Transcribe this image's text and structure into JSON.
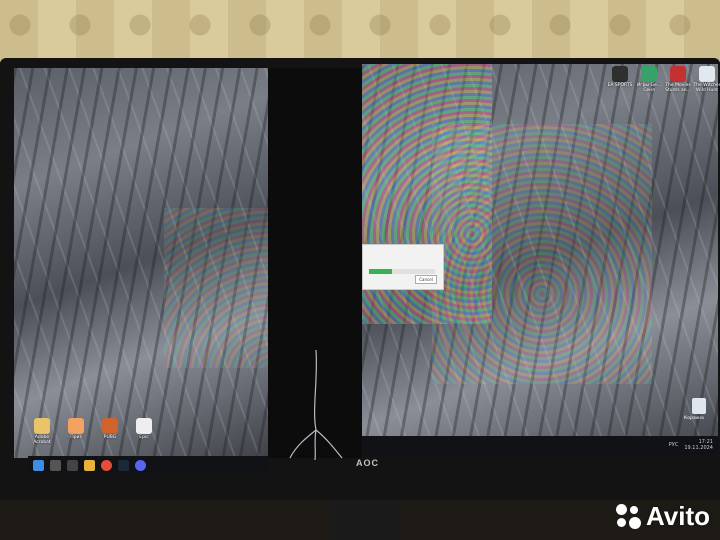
{
  "left_screen": {
    "desktop_icons": [
      {
        "label": "Adobe Acrobat",
        "color": "#e9c46a"
      },
      {
        "label": "Приз",
        "color": "#f4a261"
      },
      {
        "label": "PUBG",
        "color": "#d0632b"
      },
      {
        "label": "Epic",
        "color": "#eeeeee"
      }
    ]
  },
  "right_screen": {
    "desktop_icons": [
      {
        "label": "EA SPORTS",
        "color": "#2f2f2f"
      },
      {
        "label": "Игры Ge... Сеня",
        "color": "#38a169"
      },
      {
        "label": "The Movies Stunts an...",
        "color": "#c53030"
      },
      {
        "label": "The Witcher Wild Hunt",
        "color": "#e2e8f0"
      }
    ],
    "dialog": {
      "button": "Cancel",
      "progress": 0.35
    },
    "recycle_bin_label": "Корзина",
    "tray": {
      "lang": "РУС",
      "time": "17:21",
      "date": "19.11.2024"
    }
  },
  "monitor_brand": "AOC",
  "watermark": "Avito",
  "colors": {
    "taskbar": "#111216",
    "accent": "#37b24d"
  }
}
